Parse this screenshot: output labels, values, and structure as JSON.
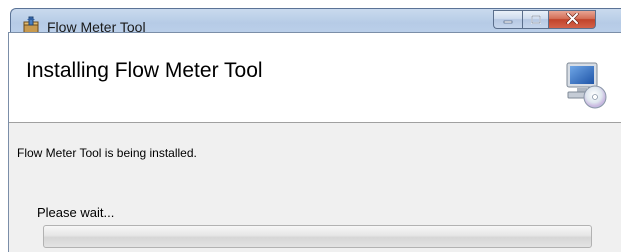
{
  "window": {
    "title": "Flow Meter Tool",
    "icons": {
      "app": "installer-box-icon",
      "minimize": "minimize-icon",
      "maximize": "maximize-icon",
      "close": "close-icon"
    }
  },
  "banner": {
    "title": "Installing Flow Meter Tool",
    "icon": "computer-disc-icon"
  },
  "main": {
    "status_text": "Flow Meter Tool is being installed.",
    "wait_text": "Please wait...",
    "progress": 0
  },
  "colors": {
    "close_button": "#c1432a",
    "titlebar": "#c4d6ee",
    "client_background": "#f0f0f0"
  }
}
